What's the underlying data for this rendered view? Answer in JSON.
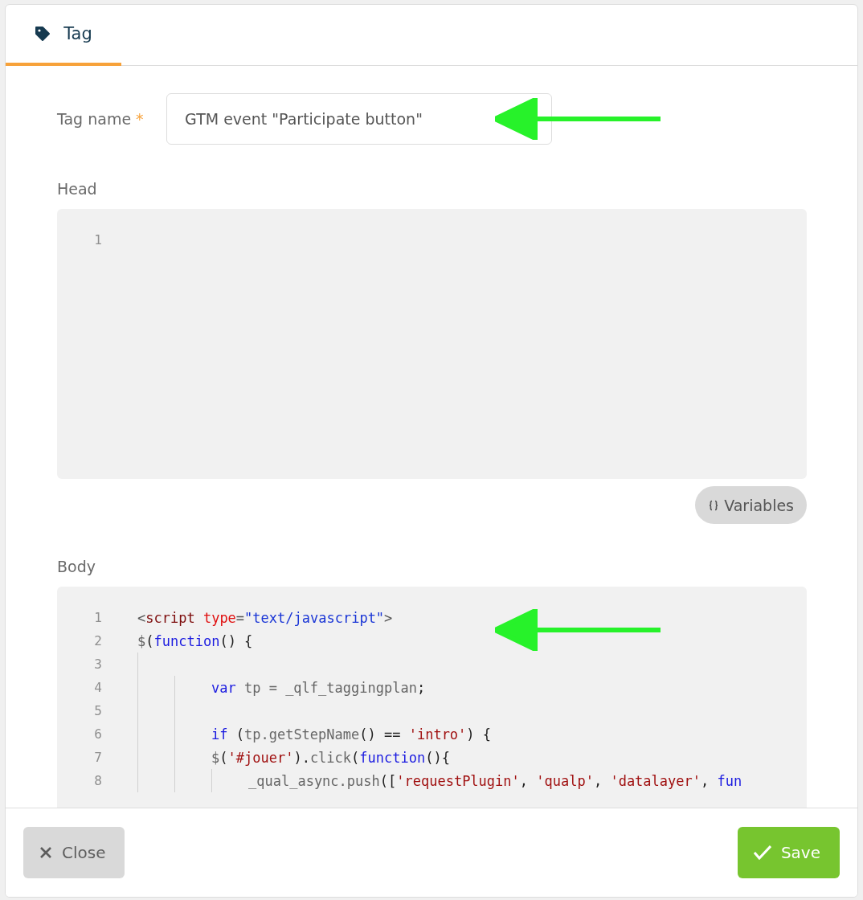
{
  "tabs": [
    {
      "label": "Tag",
      "selected": true
    }
  ],
  "tag_name": {
    "label": "Tag name",
    "required_mark": "*",
    "value": "GTM event \"Participate button\""
  },
  "head": {
    "label": "Head",
    "lines": [
      {
        "number": "1"
      }
    ]
  },
  "variables_button": "Variables",
  "body": {
    "label": "Body",
    "lines": [
      {
        "number": "1",
        "tokens": [
          {
            "kind": "punct",
            "text": "<"
          },
          {
            "kind": "tag",
            "text": "script"
          },
          {
            "kind": "attr",
            "text": " type"
          },
          {
            "kind": "punct",
            "text": "="
          },
          {
            "kind": "string",
            "text": "\"text/javascript\""
          },
          {
            "kind": "punct",
            "text": ">"
          }
        ]
      },
      {
        "number": "2",
        "tokens": [
          {
            "kind": "ident",
            "text": "$"
          },
          {
            "kind": "plain",
            "text": "("
          },
          {
            "kind": "keyword",
            "text": "function"
          },
          {
            "kind": "plain",
            "text": "() {"
          }
        ],
        "children": [
          {
            "number": "3"
          },
          {
            "children": [
              {
                "number": "4",
                "tokens": [
                  {
                    "kind": "keyword",
                    "text": "var"
                  },
                  {
                    "kind": "ident",
                    "text": " tp = _qlf_taggingplan"
                  },
                  {
                    "kind": "plain",
                    "text": ";"
                  }
                ]
              },
              {
                "number": "5"
              },
              {
                "number": "6",
                "tokens": [
                  {
                    "kind": "keyword",
                    "text": "if"
                  },
                  {
                    "kind": "plain",
                    "text": " ("
                  },
                  {
                    "kind": "ident",
                    "text": "tp.getStepName"
                  },
                  {
                    "kind": "plain",
                    "text": "() == "
                  },
                  {
                    "kind": "str2",
                    "text": "'intro'"
                  },
                  {
                    "kind": "plain",
                    "text": ") {"
                  }
                ]
              },
              {
                "number": "7",
                "tokens": [
                  {
                    "kind": "ident",
                    "text": "$"
                  },
                  {
                    "kind": "plain",
                    "text": "("
                  },
                  {
                    "kind": "str2",
                    "text": "'#jouer'"
                  },
                  {
                    "kind": "plain",
                    "text": ")."
                  },
                  {
                    "kind": "ident",
                    "text": "click"
                  },
                  {
                    "kind": "plain",
                    "text": "("
                  },
                  {
                    "kind": "keyword",
                    "text": "function"
                  },
                  {
                    "kind": "plain",
                    "text": "(){"
                  }
                ],
                "children": [
                  {
                    "number": "8",
                    "tokens": [
                      {
                        "kind": "ident",
                        "text": "_qual_async.push"
                      },
                      {
                        "kind": "plain",
                        "text": "(["
                      },
                      {
                        "kind": "str2",
                        "text": "'requestPlugin'"
                      },
                      {
                        "kind": "plain",
                        "text": ", "
                      },
                      {
                        "kind": "str2",
                        "text": "'qualp'"
                      },
                      {
                        "kind": "plain",
                        "text": ", "
                      },
                      {
                        "kind": "str2",
                        "text": "'datalayer'"
                      },
                      {
                        "kind": "plain",
                        "text": ", "
                      },
                      {
                        "kind": "keyword",
                        "text": "fun"
                      }
                    ]
                  }
                ]
              }
            ]
          }
        ]
      }
    ]
  },
  "footer": {
    "close": "Close",
    "save": "Save"
  }
}
